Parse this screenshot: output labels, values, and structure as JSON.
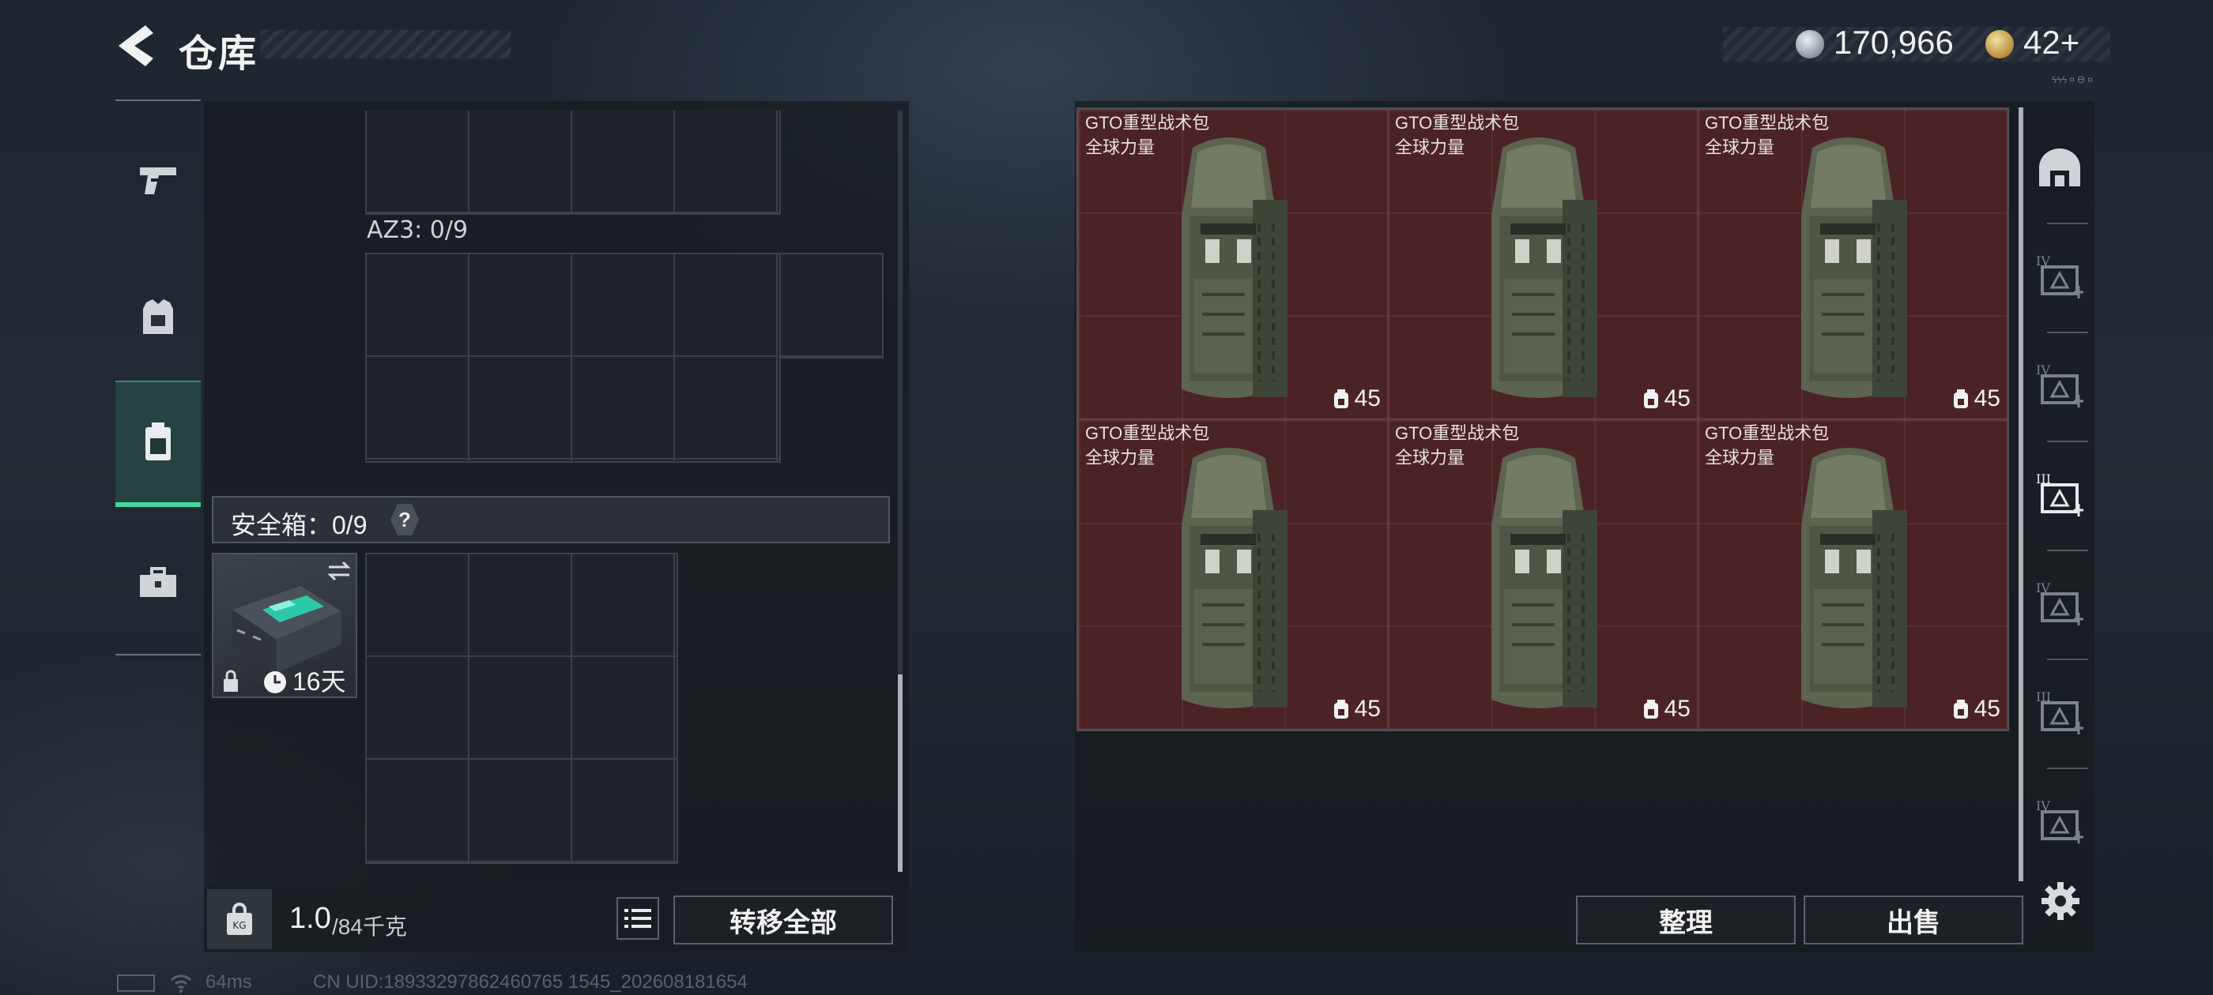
{
  "header": {
    "title": "仓库",
    "back_icon": "back-arrow-icon",
    "silver_amount": "170,966",
    "gold_amount": "42+",
    "top_right_tiny": "ϟϟϟ ¤ ϴ ¤"
  },
  "left_tabs": [
    {
      "icon": "pistol-icon",
      "active": false
    },
    {
      "icon": "armor-vest-icon",
      "active": false
    },
    {
      "icon": "backpack-icon",
      "active": true
    },
    {
      "icon": "toolbox-icon",
      "active": false
    }
  ],
  "storage": {
    "az3_label": "AZ3: 0/9",
    "safe_label": "安全箱：0/9",
    "safe_help": "?",
    "safebox_days": "16天",
    "weight_current": "1.0",
    "weight_max": "/84千克",
    "transfer_all_label": "转移全部"
  },
  "container": {
    "items": [
      {
        "name": "GTO重型战术包",
        "sub": "全球力量",
        "count": "45"
      },
      {
        "name": "GTO重型战术包",
        "sub": "全球力量",
        "count": "45"
      },
      {
        "name": "GTO重型战术包",
        "sub": "全球力量",
        "count": "45"
      },
      {
        "name": "GTO重型战术包",
        "sub": "全球力量",
        "count": "45"
      },
      {
        "name": "GTO重型战术包",
        "sub": "全球力量",
        "count": "45"
      },
      {
        "name": "GTO重型战术包",
        "sub": "全球力量",
        "count": "45"
      }
    ],
    "sort_label": "整理",
    "sell_label": "出售"
  },
  "right_sidebar": [
    {
      "icon": "helmet-icon"
    },
    {
      "icon": "tier-iv-weapon-case-icon",
      "tier": "IV"
    },
    {
      "icon": "tier-iv-folder-icon",
      "tier": "IV"
    },
    {
      "icon": "tier-iii-warning-crate-icon",
      "tier": "III"
    },
    {
      "icon": "tier-iv-medkit-icon",
      "tier": "IV"
    },
    {
      "icon": "tier-iii-warning-crate-icon",
      "tier": "III"
    },
    {
      "icon": "tier-iv-folder-icon",
      "tier": "IV"
    }
  ],
  "status": {
    "ping": "64ms",
    "uid": "CN UID:18933297862460765 1545_202608181654"
  },
  "colors": {
    "accent_green": "#3ddc9b",
    "container_cell": "#4b2226",
    "panel_bg": "#16191f"
  }
}
